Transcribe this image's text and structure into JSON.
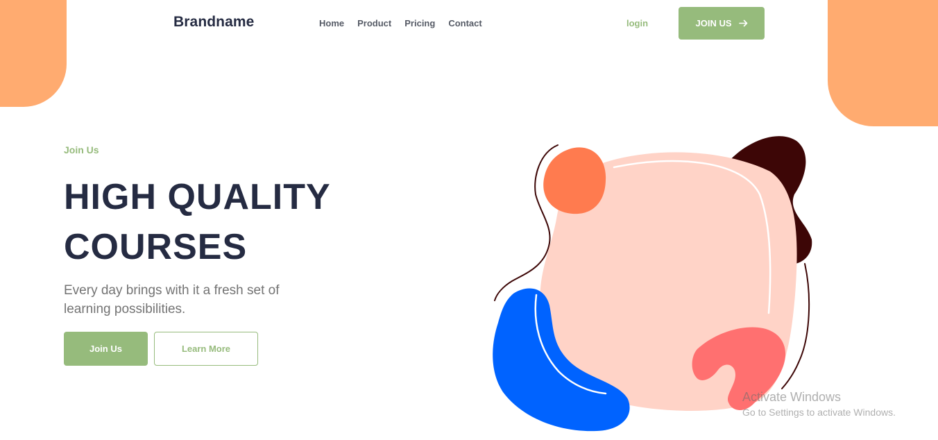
{
  "colors": {
    "accent": "#96BB7C",
    "navy": "#252B42",
    "orange": "#FFAB70",
    "muted": "#737373"
  },
  "header": {
    "brand": "Brandname",
    "nav": [
      {
        "label": "Home"
      },
      {
        "label": "Product"
      },
      {
        "label": "Pricing"
      },
      {
        "label": "Contact"
      }
    ],
    "login_label": "login",
    "join_label": "JOIN US",
    "join_icon": "arrow-right-icon"
  },
  "hero": {
    "eyebrow": "Join Us",
    "title_line1": "HIGH QUALITY",
    "title_line2": "COURSES",
    "description": "Every day brings with it a fresh set of learning possibilities.",
    "primary_button": "Join Us",
    "secondary_button": "Learn More"
  },
  "watermark": {
    "title": "Activate Windows",
    "subtitle": "Go to Settings to activate Windows."
  }
}
